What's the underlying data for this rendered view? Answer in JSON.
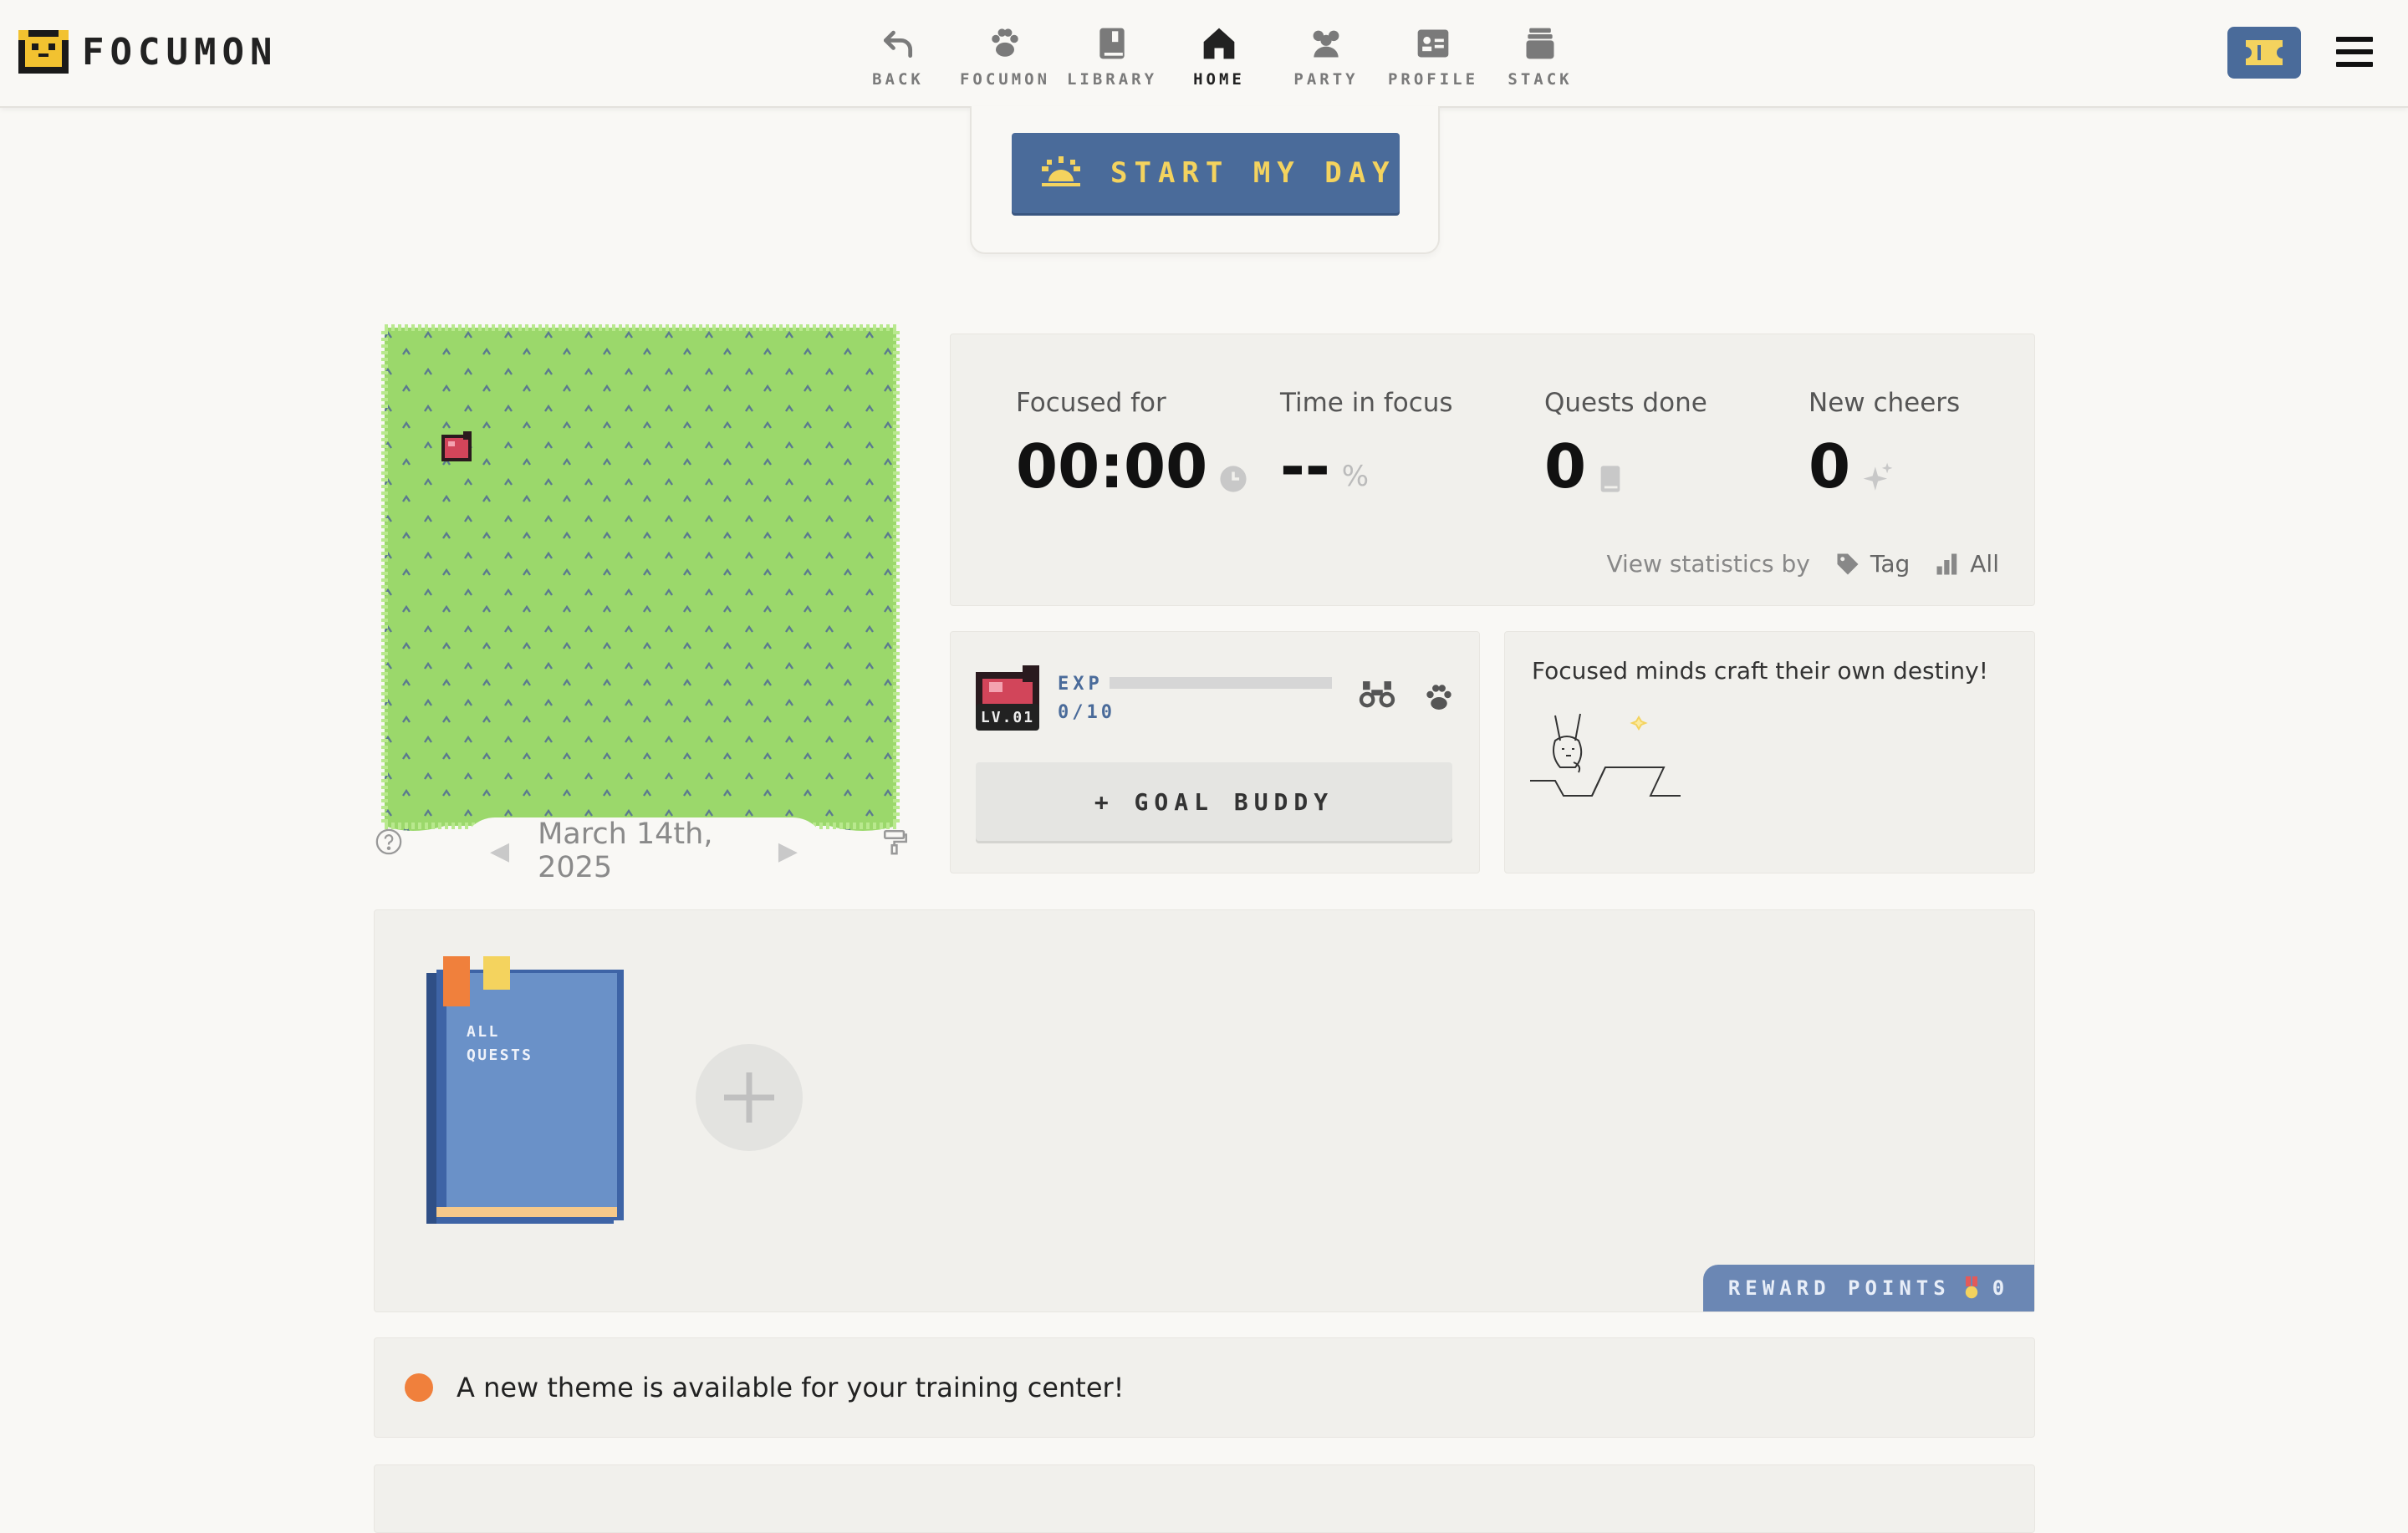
{
  "app": {
    "name": "FOCUMON"
  },
  "nav": {
    "items": [
      {
        "label": "BACK",
        "icon": "back-arrow-icon"
      },
      {
        "label": "FOCUMON",
        "icon": "paw-icon"
      },
      {
        "label": "LIBRARY",
        "icon": "book-icon"
      },
      {
        "label": "HOME",
        "icon": "home-icon",
        "active": true
      },
      {
        "label": "PARTY",
        "icon": "party-icon"
      },
      {
        "label": "PROFILE",
        "icon": "profile-card-icon"
      },
      {
        "label": "STACK",
        "icon": "stack-icon"
      }
    ]
  },
  "start": {
    "label": "START MY DAY"
  },
  "garden": {
    "date": "March 14th, 2025",
    "prev": "◀",
    "next": "▶"
  },
  "stats": {
    "focused_for": {
      "label": "Focused for",
      "value": "00:00"
    },
    "time_in_focus": {
      "label": "Time in focus",
      "value": "--",
      "suffix": "%"
    },
    "quests_done": {
      "label": "Quests done",
      "value": "0"
    },
    "new_cheers": {
      "label": "New cheers",
      "value": "0"
    },
    "view_by": {
      "label": "View statistics by",
      "tag": "Tag",
      "all": "All"
    }
  },
  "buddy": {
    "level": "LV.01",
    "exp_label": "EXP",
    "exp_value": "0/10",
    "exp_progress": 0,
    "goal_button": "+ GOAL BUDDY"
  },
  "quote": {
    "text": "Focused minds craft their own destiny!"
  },
  "quests": {
    "book_label_1": "ALL",
    "book_label_2": "QUESTS",
    "reward_label": "REWARD POINTS",
    "reward_value": "0"
  },
  "notice": {
    "text": "A new theme is available for your training center!"
  },
  "colors": {
    "accent": "#4a6b9a",
    "gold": "#f4d35e",
    "grass": "#9bd86b",
    "notice_dot": "#f0803c"
  }
}
